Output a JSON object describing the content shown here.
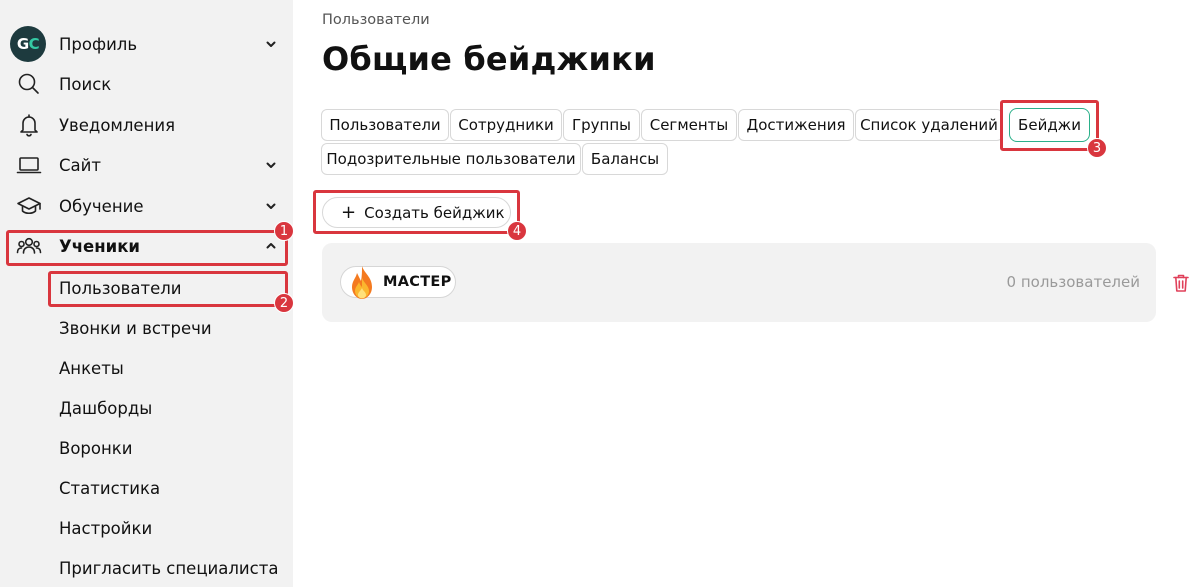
{
  "sidebar": {
    "avatar": {
      "initial_1": "G",
      "initial_2": "C"
    },
    "items": [
      {
        "label": "Профиль",
        "icon": "avatar"
      },
      {
        "label": "Поиск",
        "icon": "search-icon"
      },
      {
        "label": "Уведомления",
        "icon": "bell-icon"
      },
      {
        "label": "Сайт",
        "icon": "laptop-icon"
      },
      {
        "label": "Обучение",
        "icon": "graduation-cap-icon"
      },
      {
        "label": "Ученики",
        "icon": "users-icon"
      }
    ],
    "subitems": [
      "Пользователи",
      "Звонки и встречи",
      "Анкеты",
      "Дашборды",
      "Воронки",
      "Статистика",
      "Настройки",
      "Пригласить специалиста"
    ]
  },
  "header": {
    "breadcrumb": "Пользователи",
    "title": "Общие бейджики"
  },
  "tabs": [
    "Пользователи",
    "Сотрудники",
    "Группы",
    "Сегменты",
    "Достижения",
    "Список удалений",
    "Бейджи",
    "Подозрительные пользователи",
    "Балансы"
  ],
  "active_tab": "Бейджи",
  "create_button": {
    "label": "Создать бейджик"
  },
  "badges": [
    {
      "name": "МАСТЕР",
      "users_count": "0 пользователей",
      "icon": "flame-icon"
    }
  ],
  "annotations": [
    "1",
    "2",
    "3",
    "4"
  ],
  "colors": {
    "sidebar_bg": "#f2f2f2",
    "accent_green": "#2bb08a",
    "annotation_red": "#d9363e",
    "delete_red": "#e0405a"
  }
}
